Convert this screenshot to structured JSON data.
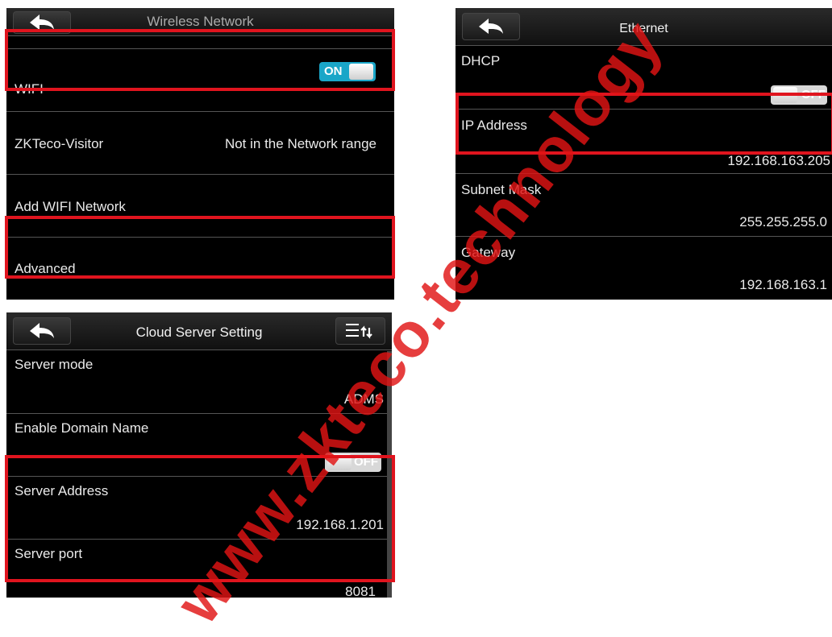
{
  "wireless": {
    "title": "Wireless Network",
    "wifi_label": "WIFI",
    "wifi_toggle": "ON",
    "visitor_label": "ZKTeco-Visitor",
    "visitor_value": "Not in the Network range",
    "add_label": "Add WIFI Network",
    "advanced_label": "Advanced"
  },
  "ethernet": {
    "title": "Ethernet",
    "dhcp_label": "DHCP",
    "dhcp_toggle": "OFF",
    "ip_label": "IP Address",
    "ip_value": "192.168.163.205",
    "subnet_label": "Subnet Mask",
    "subnet_value": "255.255.255.0",
    "gateway_label": "Gateway",
    "gateway_value": "192.168.163.1"
  },
  "cloud": {
    "title": "Cloud Server Setting",
    "server_mode_label": "Server mode",
    "server_mode_value": "ADMS",
    "domain_label": "Enable Domain Name",
    "domain_toggle": "OFF",
    "address_label": "Server Address",
    "address_value": "192.168.1.201",
    "port_label": "Server port",
    "port_value": "8081"
  },
  "watermark": "www.zkteco.technology",
  "colors": {
    "highlight_box": "#e0141e",
    "toggle_on": "#1aa6c8",
    "panel_bg": "#000000"
  },
  "icons": {
    "back": "back-arrow-icon",
    "menu": "list-sort-icon"
  }
}
